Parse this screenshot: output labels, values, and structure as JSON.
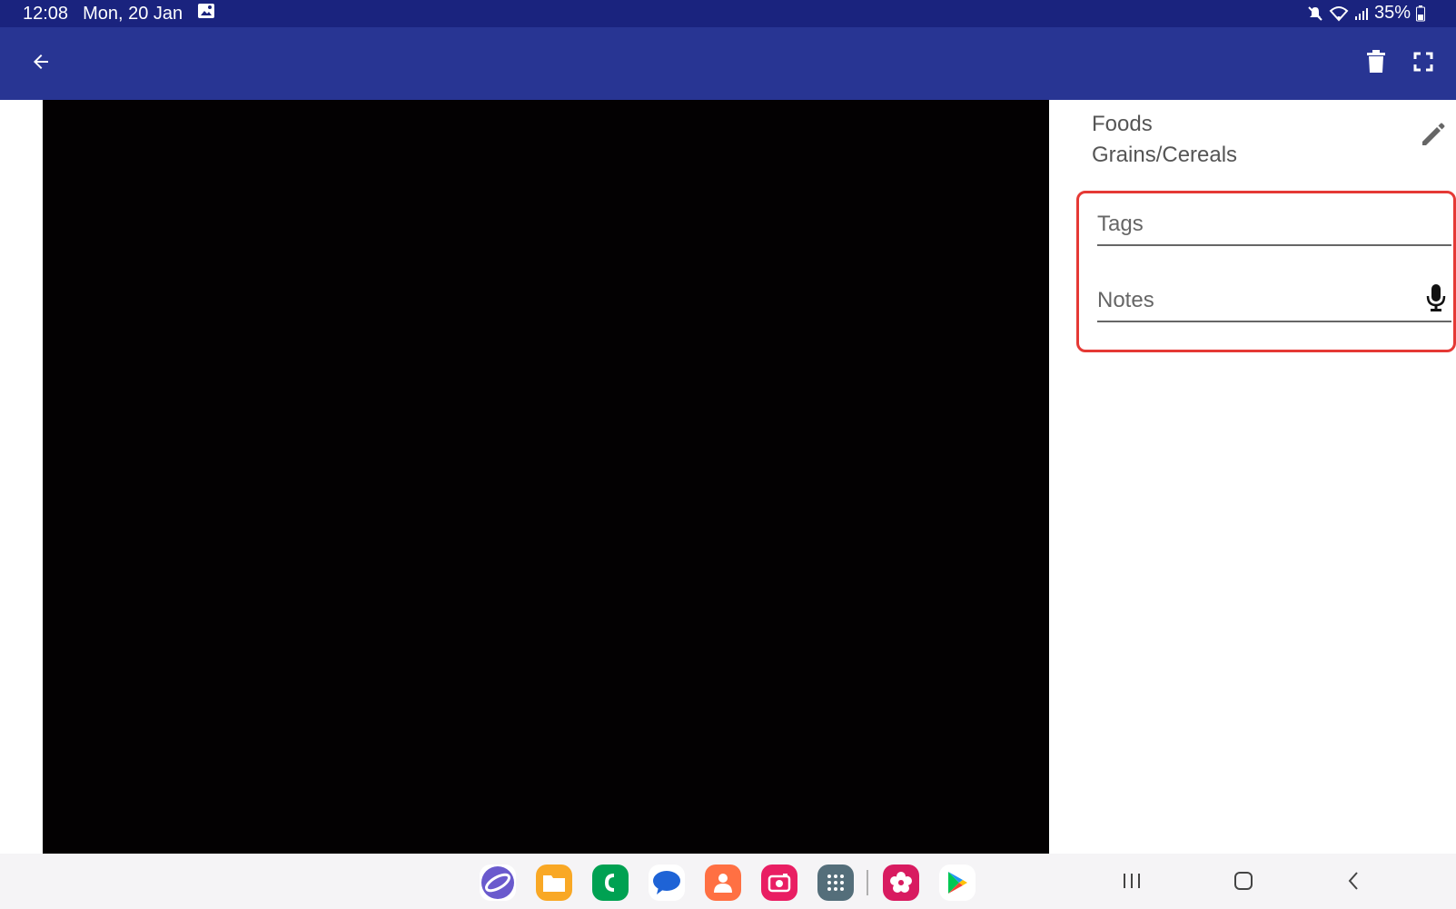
{
  "status_bar": {
    "time": "12:08",
    "date": "Mon, 20 Jan",
    "battery": "35%"
  },
  "app_bar": {
    "back_icon": "arrow-back-icon",
    "delete_icon": "trash-icon",
    "fullscreen_icon": "fullscreen-icon"
  },
  "detail": {
    "category": "Foods",
    "subcategory": "Grains/Cereals",
    "edit_icon": "pencil-icon"
  },
  "fields": {
    "tags_placeholder": "Tags",
    "notes_placeholder": "Notes",
    "mic_icon": "microphone-icon"
  },
  "dock": {
    "apps": [
      "internet-icon",
      "files-icon",
      "phone-icon",
      "messages-icon",
      "contacts-icon",
      "camera-icon",
      "apps-grid-icon",
      "gallery-icon",
      "play-store-icon"
    ]
  },
  "colors": {
    "status_bar": "#1a237e",
    "app_bar": "#283593",
    "highlight": "#e53935"
  }
}
